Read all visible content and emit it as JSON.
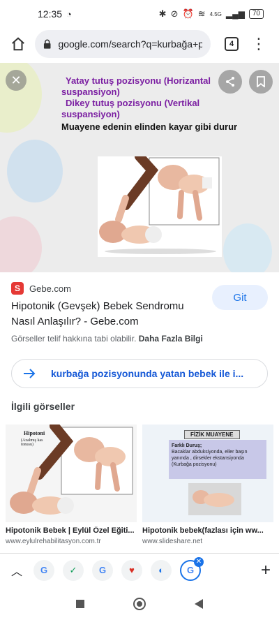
{
  "status": {
    "time": "12:35",
    "network": "4.5G",
    "battery": "70"
  },
  "browser": {
    "url": "google.com/search?q=kurbağa+po",
    "tab_count": "4"
  },
  "viewer": {
    "line1": "Yatay tutuş pozisyonu (Horizantal",
    "line2": "suspansiyon)",
    "line3": "Dikey tutuş pozisyonu (Vertikal",
    "line4": "suspansiyon)",
    "line5": "Muayene edenin elinden kayar gibi durur"
  },
  "result": {
    "source": "Gebe.com",
    "favicon_letter": "S",
    "title": "Hipotonik (Gevşek) Bebek Sendromu Nasıl Anlaşılır? - Gebe.com",
    "copyright_prefix": "Görseller telif hakkına tabi olabilir.",
    "copyright_link": "Daha Fazla Bilgi",
    "visit_label": "Git"
  },
  "related_search": {
    "text": "kurbağa pozisyonunda yatan bebek ile i..."
  },
  "related_images": {
    "title": "İlgili görseller",
    "items": [
      {
        "img_label_1": "Hipotoni",
        "img_label_2": "(Azalmış kas tonusu)",
        "title": "Hipotonik Bebek | Eylül Özel Eğiti...",
        "domain": "www.eylulrehabilitasyon.com.tr"
      },
      {
        "img_heading": "FİZİK MUAYENE",
        "img_line1": "Farklı Duruş;",
        "img_line2": "Bacaklar abduksiyonda, eller başın yanında , dirsekler ekstansiyonda (Kurbağa pozisyonu)",
        "title": "Hipotonik bebek(fazlası için ww...",
        "domain": "www.slideshare.net"
      }
    ]
  },
  "tabs": {
    "chips": [
      "G",
      "✓",
      "G",
      "♥",
      "◐",
      "G"
    ]
  }
}
